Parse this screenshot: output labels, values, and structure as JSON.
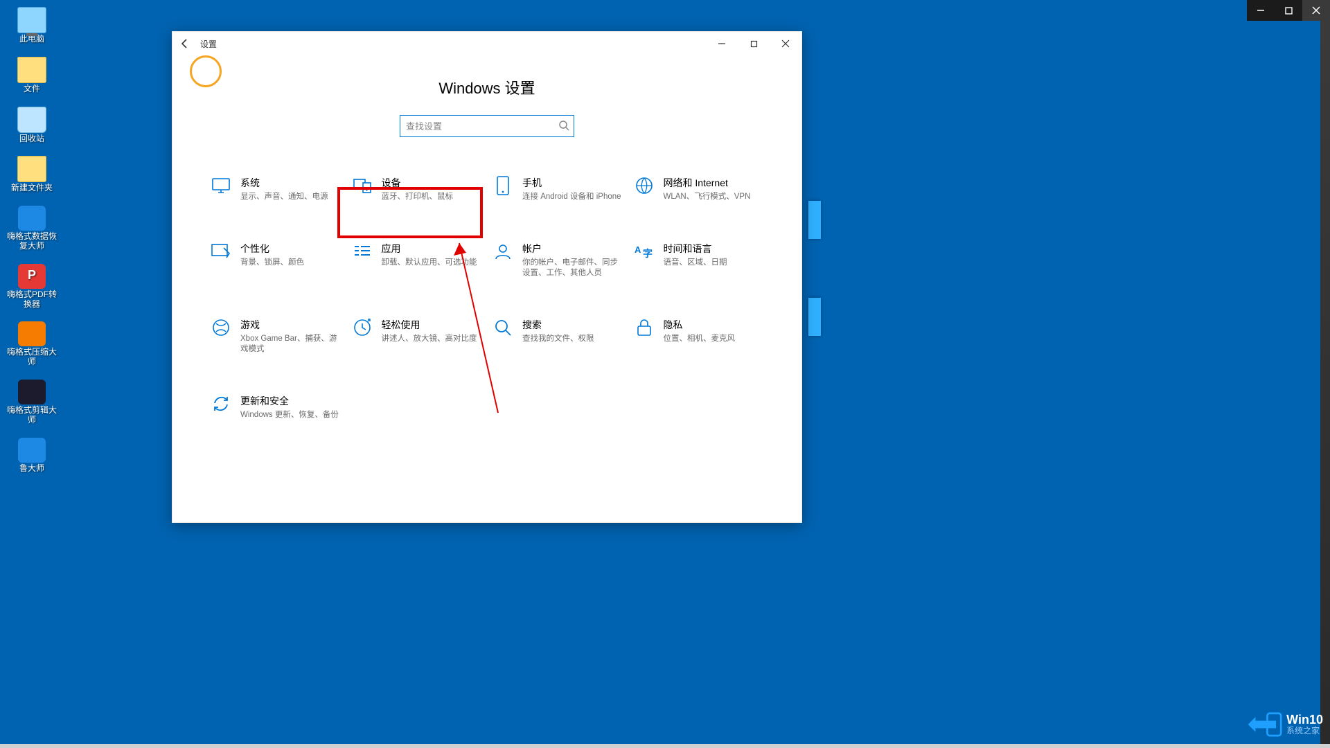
{
  "desktop_icons": [
    {
      "name": "此电脑",
      "glyph": "computer"
    },
    {
      "name": "文件",
      "glyph": "folder"
    },
    {
      "name": "回收站",
      "glyph": "recycle"
    },
    {
      "name": "新建文件夹",
      "glyph": "folder"
    },
    {
      "name": "嗨格式数据恢复大师",
      "glyph": "app1"
    },
    {
      "name": "嗨格式PDF转换器",
      "glyph": "app-red"
    },
    {
      "name": "嗨格式压缩大师",
      "glyph": "app-orange"
    },
    {
      "name": "嗨格式剪辑大师",
      "glyph": "app-dark"
    },
    {
      "name": "鲁大师",
      "glyph": "app-blue"
    }
  ],
  "settings": {
    "window_title": "设置",
    "heading": "Windows 设置",
    "search_placeholder": "查找设置",
    "tiles": [
      {
        "id": "system",
        "title": "系统",
        "sub": "显示、声音、通知、电源"
      },
      {
        "id": "devices",
        "title": "设备",
        "sub": "蓝牙、打印机、鼠标"
      },
      {
        "id": "phone",
        "title": "手机",
        "sub": "连接 Android 设备和 iPhone"
      },
      {
        "id": "network",
        "title": "网络和 Internet",
        "sub": "WLAN、飞行模式、VPN"
      },
      {
        "id": "personalization",
        "title": "个性化",
        "sub": "背景、锁屏、颜色"
      },
      {
        "id": "apps",
        "title": "应用",
        "sub": "卸载、默认应用、可选功能"
      },
      {
        "id": "accounts",
        "title": "帐户",
        "sub": "你的帐户、电子邮件、同步设置、工作、其他人员"
      },
      {
        "id": "time",
        "title": "时间和语言",
        "sub": "语音、区域、日期"
      },
      {
        "id": "gaming",
        "title": "游戏",
        "sub": "Xbox Game Bar、捕获、游戏模式"
      },
      {
        "id": "ease",
        "title": "轻松使用",
        "sub": "讲述人、放大镜、高对比度"
      },
      {
        "id": "search",
        "title": "搜索",
        "sub": "查找我的文件、权限"
      },
      {
        "id": "privacy",
        "title": "隐私",
        "sub": "位置、相机、麦克风"
      },
      {
        "id": "update",
        "title": "更新和安全",
        "sub": "Windows 更新、恢复、备份"
      }
    ]
  },
  "watermark": {
    "brand": "Win10",
    "sub": "系统之家"
  }
}
